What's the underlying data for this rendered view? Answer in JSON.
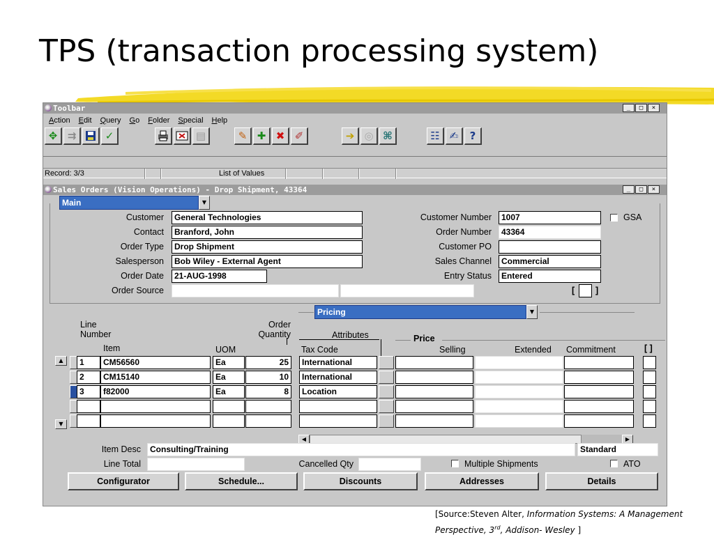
{
  "slide": {
    "title": "TPS (transaction processing system)",
    "source_prefix": "[Source:Steven Alter, ",
    "source_title": "Information Systems: A Management Perspective, 3",
    "source_sup": "rd",
    "source_publisher": ", Addison- Wesley",
    "source_suffix": " ]"
  },
  "toolbar_window": {
    "title": "Toolbar",
    "window_buttons": [
      "_",
      "□",
      "×"
    ],
    "menu": [
      "Action",
      "Edit",
      "Query",
      "Go",
      "Folder",
      "Special",
      "Help"
    ],
    "icons": [
      [
        "new-record-icon",
        "copy-icon",
        "save-icon",
        "check-icon"
      ],
      [
        "print-icon",
        "close-form-icon",
        "zoom-icon"
      ],
      [
        "edit-icon",
        "add-record-icon",
        "delete-record-icon",
        "clear-icon"
      ],
      [
        "next-icon",
        "translate-icon",
        "attachment-icon"
      ],
      [
        "folder-tools-icon",
        "edit-field-icon",
        "help-icon"
      ]
    ]
  },
  "status": {
    "record": "Record: 3/3",
    "list_of_values": "List of Values"
  },
  "sales_window": {
    "title": "Sales Orders (Vision Operations) - Drop Shipment, 43364",
    "window_buttons": [
      "_",
      "□",
      "×"
    ],
    "region": "Main"
  },
  "header": {
    "customer_label": "Customer",
    "customer": "General Technologies",
    "contact_label": "Contact",
    "contact": "Branford, John",
    "order_type_label": "Order Type",
    "order_type": "Drop Shipment",
    "salesperson_label": "Salesperson",
    "salesperson_name": "Bob Wiley",
    "salesperson_role": " - External Agent",
    "order_date_label": "Order Date",
    "order_date": "21-AUG-1998",
    "order_source_label": "Order Source",
    "customer_number_label": "Customer Number",
    "customer_number": "1007",
    "gsa_label": "GSA",
    "order_number_label": "Order Number",
    "order_number": "43364",
    "customer_po_label": "Customer PO",
    "sales_channel_label": "Sales Channel",
    "sales_channel": "Commercial",
    "entry_status_label": "Entry Status",
    "entry_status": "Entered",
    "flex_open": "[",
    "flex_close": "]"
  },
  "lines": {
    "region": "Pricing",
    "col_line_number": "Line\nNumber",
    "col_line_1": "Line",
    "col_line_2": "Number",
    "col_item": "Item",
    "col_uom": "UOM",
    "col_order_qty_1": "Order",
    "col_order_qty_2": "Quantity",
    "col_attributes": "Attributes",
    "col_tax_code": "Tax Code",
    "col_price": "Price",
    "col_selling": "Selling",
    "col_extended": "Extended",
    "col_commitment": "Commitment",
    "col_flex": "[ ]",
    "rows": [
      {
        "line": "1",
        "item": "CM56560",
        "uom": "Ea",
        "qty": "25",
        "tax": "International"
      },
      {
        "line": "2",
        "item": "CM15140",
        "uom": "Ea",
        "qty": "10",
        "tax": "International"
      },
      {
        "line": "3",
        "item": "f82000",
        "uom": "Ea",
        "qty": "8",
        "tax": "Location"
      },
      {
        "line": "",
        "item": "",
        "uom": "",
        "qty": "",
        "tax": ""
      },
      {
        "line": "",
        "item": "",
        "uom": "",
        "qty": "",
        "tax": ""
      }
    ]
  },
  "footer": {
    "item_desc_label": "Item Desc",
    "item_desc": "Consulting/Training",
    "item_type": "Standard",
    "line_total_label": "Line Total",
    "cancelled_qty_label": "Cancelled Qty",
    "multiple_shipments_label": "Multiple Shipments",
    "ato_label": "ATO"
  },
  "buttons": {
    "configurator": "Configurator",
    "schedule": "Schedule...",
    "discounts": "Discounts",
    "addresses": "Addresses",
    "details": "Details"
  }
}
